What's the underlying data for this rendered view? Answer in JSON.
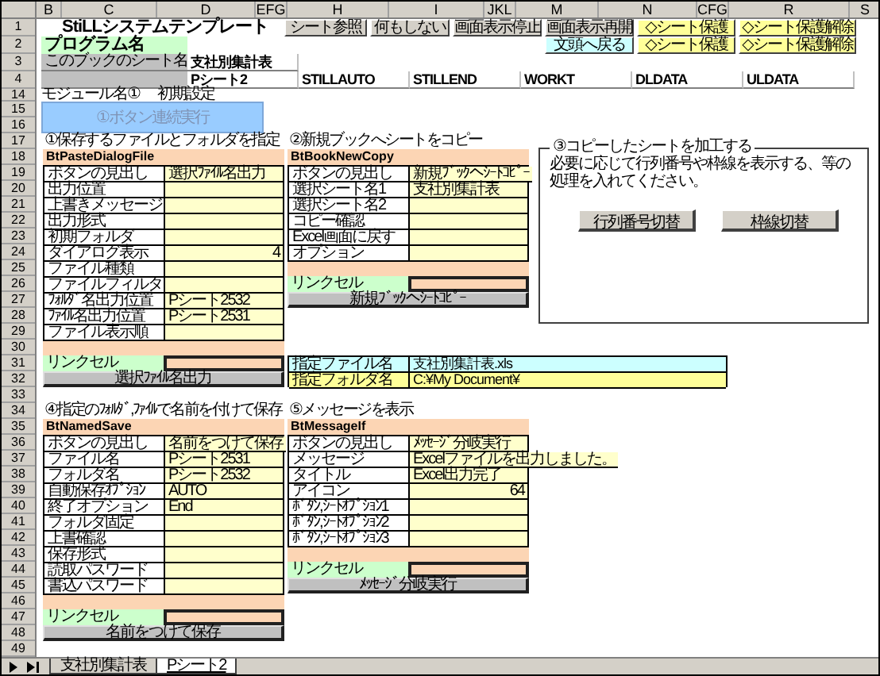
{
  "column_headers": [
    "B",
    "C",
    "D",
    "EFG",
    "H",
    "I",
    "JKL",
    "M",
    "N",
    "CFG",
    "R",
    "S"
  ],
  "row_numbers": [
    "1",
    "2",
    "3",
    "4",
    "14",
    "15",
    "16",
    "17",
    "18",
    "19",
    "20",
    "21",
    "22",
    "23",
    "24",
    "25",
    "26",
    "27",
    "28",
    "29",
    "30",
    "31",
    "32",
    "33",
    "34",
    "35",
    "36",
    "37",
    "38",
    "39",
    "40",
    "41",
    "42",
    "43",
    "44",
    "45",
    "46",
    "47",
    "48",
    "49"
  ],
  "title": "StiLLシステムテンプレート",
  "toolbar_row1": [
    {
      "label": "シート参照",
      "kind": "gray"
    },
    {
      "label": "何もしない",
      "kind": "gray"
    },
    {
      "label": "画面表示停止",
      "kind": "gray"
    },
    {
      "label": "画面表示再開",
      "kind": "gray"
    },
    {
      "label": "◇シート保護",
      "kind": "yellow"
    },
    {
      "label": "◇シート保護解除",
      "kind": "yellow"
    }
  ],
  "program_label": "プログラム名",
  "toolbar_row2": [
    {
      "label": "文頭へ戻る",
      "kind": "cyan"
    },
    {
      "label": "◇シート保護",
      "kind": "yellow"
    },
    {
      "label": "◇シート保護解除",
      "kind": "yellow"
    }
  ],
  "sheet_name_label": "このブックのシート名",
  "sheet_name": "支社別集計表",
  "sheet_list": [
    "Pシート2",
    "STILLAUTO",
    "STILLEND",
    "WORKT",
    "DLDATA",
    "ULDATA"
  ],
  "module_label": "モジュール名①",
  "module_value": "初期設定",
  "run_all_button": {
    "label": "①ボタン連続実行",
    "disabled": true
  },
  "blocks": [
    {
      "title": "①保存するファイルとフォルダを指定",
      "control": "BtPasteDialogFile",
      "link_label": "リンクセル",
      "button": "選択ﾌｧｲﾙ名出力",
      "fields": [
        {
          "label": "ボタンの見出し",
          "value": "選択ﾌｧｲﾙ名出力",
          "kind": "text"
        },
        {
          "label": "出力位置",
          "kind": "text"
        },
        {
          "label": "上書きメッセージ",
          "kind": "text"
        },
        {
          "label": "出力形式",
          "kind": "text"
        },
        {
          "label": "初期フォルダ",
          "kind": "text"
        },
        {
          "label": "ダイアログ表示",
          "value": "4",
          "kind": "number"
        },
        {
          "label": "ファイル種類",
          "kind": "text"
        },
        {
          "label": "ファイルフィルタ",
          "kind": "text"
        },
        {
          "label": "ﾌｫﾙﾀﾞ名出力位置",
          "value": "Pシート2532",
          "kind": "text"
        },
        {
          "label": "ﾌｧｲﾙ名出力位置",
          "value": "Pシート2531",
          "kind": "text"
        },
        {
          "label": "ファイル表示順",
          "kind": "text"
        }
      ]
    },
    {
      "title": "②新規ブックへシートをコピー",
      "control": "BtBookNewCopy",
      "link_label": "リンクセル",
      "button": "新規ﾌﾞｯｸへｼｰﾄｺﾋﾟｰ",
      "fields": [
        {
          "label": "ボタンの見出し",
          "value": "新規ﾌﾞｯｸへｼｰﾄｺﾋﾟｰ",
          "kind": "text"
        },
        {
          "label": "選択シート名1",
          "value": "支社別集計表",
          "kind": "text"
        },
        {
          "label": "選択シート名2",
          "kind": "text"
        },
        {
          "label": "コピー確認",
          "kind": "text"
        },
        {
          "label": "Excel画面に戻す",
          "kind": "text"
        },
        {
          "label": "オプション",
          "kind": "text"
        }
      ]
    },
    {
      "title": "④指定のﾌｫﾙﾀﾞ,ﾌｧｲﾙで名前を付けて保存",
      "control": "BtNamedSave",
      "link_label": "リンクセル",
      "button": "名前をつけて保存",
      "fields": [
        {
          "label": "ボタンの見出し",
          "value": "名前をつけて保存",
          "kind": "text"
        },
        {
          "label": "ファイル名",
          "value": "Pシート2531",
          "kind": "text"
        },
        {
          "label": "フォルダ名",
          "value": "Pシート2532",
          "kind": "text"
        },
        {
          "label": "自動保存ｵﾌﾟｼｮﾝ",
          "value": "AUTO",
          "kind": "text"
        },
        {
          "label": "終了オプション",
          "value": "End",
          "kind": "text"
        },
        {
          "label": "フォルダ固定",
          "kind": "text"
        },
        {
          "label": "上書確認",
          "kind": "text"
        },
        {
          "label": "保存形式",
          "kind": "text"
        },
        {
          "label": "読取パスワード",
          "kind": "text"
        },
        {
          "label": "書込パスワード",
          "kind": "text"
        }
      ]
    },
    {
      "title": "⑤メッセージを表示",
      "control": "BtMessageIf",
      "link_label": "リンクセル",
      "button": "ﾒｯｾｰｼﾞ分岐実行",
      "fields": [
        {
          "label": "ボタンの見出し",
          "value": "ﾒｯｾｰｼﾞ分岐実行",
          "kind": "text"
        },
        {
          "label": "メッセージ",
          "value": "Excelファイルを出力しました。",
          "kind": "text"
        },
        {
          "label": "タイトル",
          "value": "Excel出力完了",
          "kind": "text"
        },
        {
          "label": "アイコン",
          "value": "64",
          "kind": "number"
        },
        {
          "label": "ﾎﾞﾀﾝ,ｼｰﾄｵﾌﾟｼｮﾝ1",
          "kind": "text"
        },
        {
          "label": "ﾎﾞﾀﾝ,ｼｰﾄｵﾌﾟｼｮﾝ2",
          "kind": "text"
        },
        {
          "label": "ﾎﾞﾀﾝ,ｼｰﾄｵﾌﾟｼｮﾝ3",
          "kind": "text"
        }
      ]
    }
  ],
  "process_box": {
    "title": "③コピーしたシートを加工する",
    "text": "必要に応じて行列番号や枠線を表示する、等の処理を入れてください。",
    "buttons": [
      "行列番号切替",
      "枠線切替"
    ]
  },
  "file_info": [
    {
      "label": "指定ファイル名",
      "value": "支社別集計表.xls",
      "color": "#ccffff"
    },
    {
      "label": "指定フォルダ名",
      "value": "C:¥My Document¥",
      "color": "#ffff99"
    }
  ],
  "sheet_tabs": [
    {
      "label": "支社別集計表",
      "selected": false
    },
    {
      "label": "Pシート2",
      "selected": true
    }
  ]
}
